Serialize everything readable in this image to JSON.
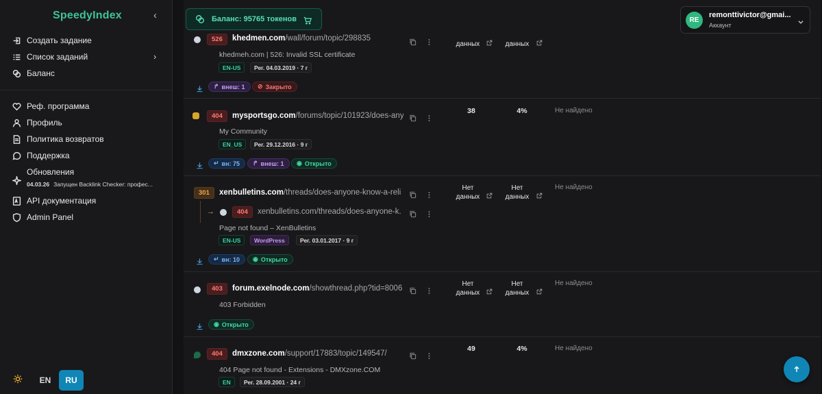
{
  "brand": "SpeedyIndex",
  "sidebar": {
    "items": [
      {
        "label": "Создать задание",
        "icon": "create-task-icon"
      },
      {
        "label": "Список заданий",
        "icon": "task-list-icon"
      },
      {
        "label": "Баланс",
        "icon": "coins-icon"
      },
      {
        "label": "Реф. программа",
        "icon": "referral-icon"
      },
      {
        "label": "Профиль",
        "icon": "user-icon"
      },
      {
        "label": "Политика возвратов",
        "icon": "document-icon"
      },
      {
        "label": "Поддержка",
        "icon": "chat-icon"
      },
      {
        "label": "Обновления",
        "icon": "sparkle-icon"
      },
      {
        "label": "API документация",
        "icon": "api-doc-icon"
      },
      {
        "label": "Admin Panel",
        "icon": "shield-icon"
      }
    ],
    "update": {
      "date": "04.03.26",
      "text": "Запущен Backlink Checker: профес..."
    },
    "lang": {
      "en": "EN",
      "ru": "RU"
    }
  },
  "topbar": {
    "balance": "Баланс: 95765 токенов",
    "account": {
      "initials": "RE",
      "name": "remonttivictor@gmai...",
      "sub": "Аккаунт"
    }
  },
  "rows": [
    {
      "code": "526",
      "domain": "khedmen.com",
      "path": "/wall/forum/topic/298835",
      "title": "khedmeh.com | 526: Invalid SSL certificate",
      "tags": [
        "EN-US",
        "Рег. 04.03.2019 · 7 г"
      ],
      "pills": [
        "внеш: 1",
        "Закрыто"
      ],
      "m1": "данных",
      "m2": "данных"
    },
    {
      "code": "404",
      "domain": "mysportsgo.com",
      "path": "/forums/topic/101923/does-anyo...",
      "title": "My Community",
      "tags": [
        "EN_US",
        "Рег. 29.12.2016 · 9 г"
      ],
      "pills": [
        "вн: 75",
        "внеш: 1",
        "Открыто"
      ],
      "m1": "38",
      "m2": "4%",
      "status": "Не найдено"
    },
    {
      "code": "301",
      "domain": "xenbulletins.com",
      "path": "/threads/does-anyone-know-a-reli...",
      "redirect_code": "404",
      "redirect_url": "xenbulletins.com/threads/does-anyone-k...",
      "title": "Page not found – XenBulletins",
      "tags": [
        "EN-US",
        "WordPress",
        "Рег. 03.01.2017 · 9 г"
      ],
      "pills": [
        "вн: 10",
        "Открыто"
      ],
      "m1a": "Нет",
      "m1b": "данных",
      "m2a": "Нет",
      "m2b": "данных",
      "status": "Не найдено"
    },
    {
      "code": "403",
      "domain": "forum.exelnode.com",
      "path": "/showthread.php?tid=8006",
      "title": "403 Forbidden",
      "pills": [
        "Открыто"
      ],
      "m1a": "Нет",
      "m1b": "данных",
      "m2a": "Нет",
      "m2b": "данных",
      "status": "Не найдено"
    },
    {
      "code": "404",
      "domain": "dmxzone.com",
      "path": "/support/17883/topic/149547/",
      "title": "404 Page not found - Extensions - DMXzone.COM",
      "tags": [
        "EN",
        "Рег. 28.09.2001 · 24 г"
      ],
      "m1": "49",
      "m2": "4%",
      "status": "Не найдено"
    }
  ],
  "colors": {
    "accent": "#3ec29a",
    "primary": "#0f86b6",
    "bg": "#141416"
  }
}
